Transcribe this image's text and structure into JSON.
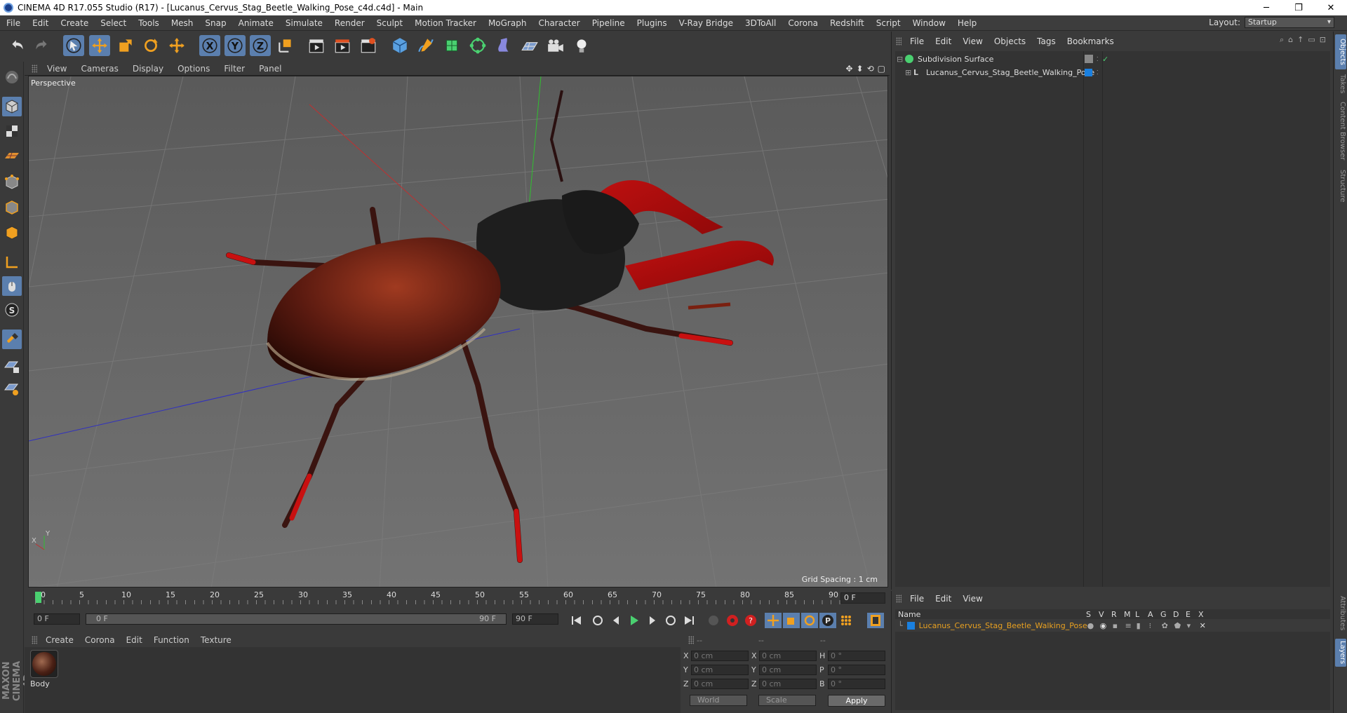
{
  "window": {
    "title": "CINEMA 4D R17.055 Studio (R17) - [Lucanus_Cervus_Stag_Beetle_Walking_Pose_c4d.c4d] - Main",
    "minimize": "─",
    "maximize": "❐",
    "close": "✕"
  },
  "menubar": {
    "items": [
      "File",
      "Edit",
      "Create",
      "Select",
      "Tools",
      "Mesh",
      "Snap",
      "Animate",
      "Simulate",
      "Render",
      "Sculpt",
      "Motion Tracker",
      "MoGraph",
      "Character",
      "Pipeline",
      "Plugins",
      "V-Ray Bridge",
      "3DToAll",
      "Corona",
      "Redshift",
      "Script",
      "Window",
      "Help"
    ],
    "layout_label": "Layout:",
    "layout_value": "Startup"
  },
  "toolbar": {
    "tools": [
      "undo-icon",
      "redo-icon",
      "select-arrow-icon",
      "move-icon",
      "scale-icon",
      "rotate-icon",
      "transform-icon",
      "x-axis-icon",
      "y-axis-icon",
      "z-axis-icon",
      "coordinate-system-icon",
      "render-view-icon",
      "render-picture-viewer-icon",
      "render-settings-icon",
      "cube-icon",
      "pen-spline-icon",
      "subdivision-icon",
      "array-icon",
      "deformer-icon",
      "floor-icon",
      "camera-icon",
      "light-icon"
    ],
    "axis_labels": [
      "X",
      "Y",
      "Z"
    ]
  },
  "viewport": {
    "menu": [
      "View",
      "Cameras",
      "Display",
      "Options",
      "Filter",
      "Panel"
    ],
    "label": "Perspective",
    "grid_spacing": "Grid Spacing : 1 cm",
    "axis_x": "X",
    "axis_y": "Y"
  },
  "timeline": {
    "ticks": [
      "0",
      "5",
      "10",
      "15",
      "20",
      "25",
      "30",
      "35",
      "40",
      "45",
      "50",
      "55",
      "60",
      "65",
      "70",
      "75",
      "80",
      "85",
      "90"
    ],
    "current_frame": "0 F",
    "start_field": "0 F",
    "range_start": "0 F",
    "range_end": "90 F",
    "end_field": "90 F"
  },
  "material_manager": {
    "menu": [
      "Create",
      "Corona",
      "Edit",
      "Function",
      "Texture"
    ],
    "materials": [
      {
        "name": "Body"
      }
    ]
  },
  "coordinates": {
    "header": [
      "--",
      "--",
      "--"
    ],
    "rows": [
      {
        "axis": "X",
        "pos": "0 cm",
        "axis2": "X",
        "size": "0 cm",
        "rot_label": "H",
        "rot": "0 °"
      },
      {
        "axis": "Y",
        "pos": "0 cm",
        "axis2": "Y",
        "size": "0 cm",
        "rot_label": "P",
        "rot": "0 °"
      },
      {
        "axis": "Z",
        "pos": "0 cm",
        "axis2": "Z",
        "size": "0 cm",
        "rot_label": "B",
        "rot": "0 °"
      }
    ],
    "mode": "World",
    "size_mode": "Scale",
    "apply": "Apply"
  },
  "object_manager": {
    "menu": [
      "File",
      "Edit",
      "View",
      "Objects",
      "Tags",
      "Bookmarks"
    ],
    "objects": [
      {
        "name": "Subdivision Surface"
      },
      {
        "name": "Lucanus_Cervus_Stag_Beetle_Walking_Pose"
      }
    ]
  },
  "layer_manager": {
    "menu": [
      "File",
      "Edit",
      "View"
    ],
    "columns": [
      "Name",
      "S",
      "V",
      "R",
      "M",
      "L",
      "A",
      "G",
      "D",
      "E",
      "X"
    ],
    "layers": [
      {
        "name": "Lucanus_Cervus_Stag_Beetle_Walking_Pose"
      }
    ]
  },
  "side_tabs": [
    "Objects",
    "Takes",
    "Content Browser",
    "Structure",
    "Attributes",
    "Layers"
  ],
  "branding": "MAXON CINEMA 4D",
  "colors": {
    "accent": "#5b7fae",
    "layer_color": "#e8a020",
    "viewport_bg": "#6a6a6a"
  }
}
